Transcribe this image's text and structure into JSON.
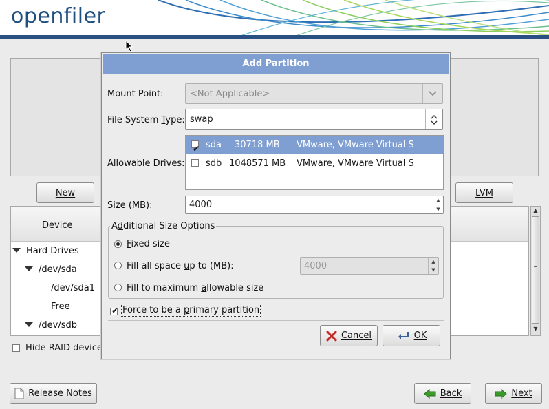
{
  "app": {
    "logo_text": "openfiler"
  },
  "main": {
    "buttons": {
      "new": "New",
      "lvm": "LVM"
    },
    "tree": {
      "column_header": "Device",
      "items": [
        "Hard Drives",
        "/dev/sda",
        "/dev/sda1",
        "Free",
        "/dev/sdb"
      ]
    },
    "hide_raid_label": "Hide RAID device/"
  },
  "dialog": {
    "title": "Add Partition",
    "mount_point": {
      "label": "Mount Point:",
      "value": "<Not Applicable>"
    },
    "fs_type": {
      "label_pre": "File System ",
      "label_ul": "T",
      "label_post": "ype:",
      "value": "swap"
    },
    "allowable_drives": {
      "label_pre": "Allowable ",
      "label_ul": "D",
      "label_post": "rives:",
      "drives": [
        {
          "name": "sda",
          "size": "30718 MB",
          "model": "VMware, VMware Virtual S",
          "checked": true,
          "selected": true
        },
        {
          "name": "sdb",
          "size": "1048571 MB",
          "model": "VMware, VMware Virtual S",
          "checked": false,
          "selected": false
        }
      ]
    },
    "size": {
      "label_ul": "S",
      "label_post": "ize (MB):",
      "value": "4000"
    },
    "additional": {
      "legend_pre": "A",
      "legend_ul": "d",
      "legend_post": "ditional Size Options",
      "fixed": {
        "ul": "F",
        "post": "ixed size"
      },
      "fill_up": {
        "pre": "Fill all space ",
        "ul": "u",
        "post": "p to (MB):",
        "value": "4000"
      },
      "fill_max": {
        "pre": "Fill to maximum ",
        "ul": "a",
        "post": "llowable size"
      },
      "selected": "fixed"
    },
    "primary": {
      "pre": "Force to be a ",
      "ul": "p",
      "post": "rimary partition",
      "checked": true
    },
    "cancel_label": "Cancel",
    "ok_label": "OK"
  },
  "footer": {
    "release_notes": "Release Notes",
    "back": "Back",
    "next": "Next"
  },
  "colors": {
    "dialog_title_bg": "#7f9fd2",
    "selection_bg": "#7f9fd2",
    "header_bar": "#2a4f83",
    "cancel_icon": "#c62828",
    "nav_arrow": "#3a9a2a"
  }
}
